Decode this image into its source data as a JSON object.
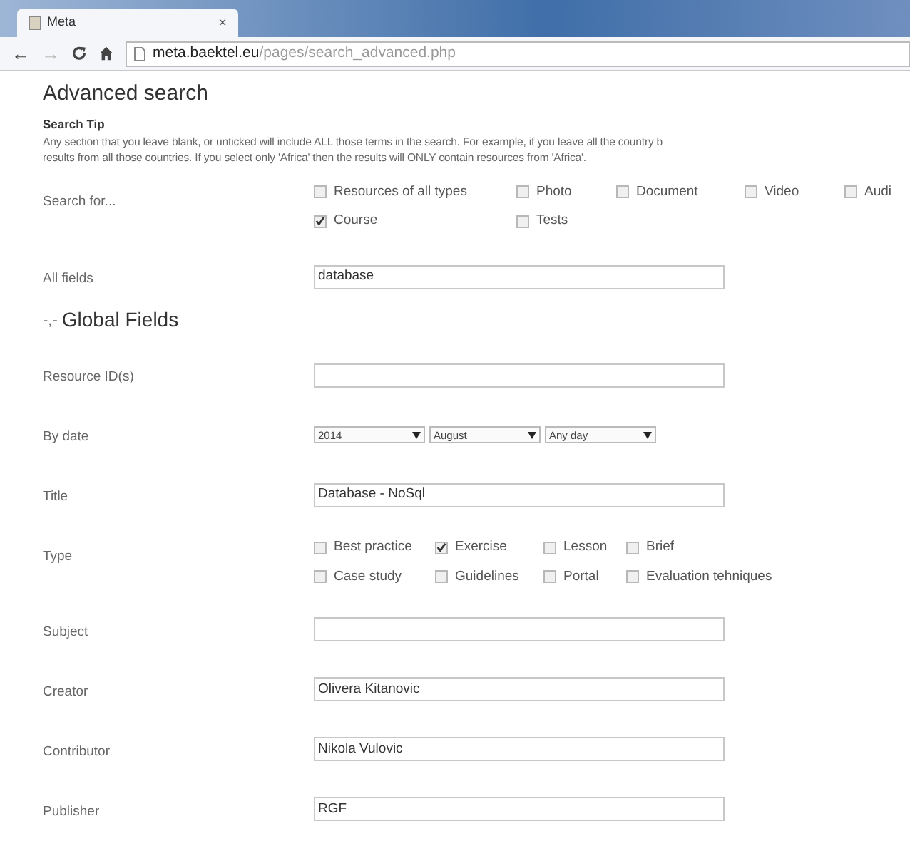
{
  "browser": {
    "tabs": [
      {
        "title": "Meta",
        "close": "×",
        "selected": true
      }
    ],
    "nav": {
      "back": "←",
      "forward": "→"
    },
    "address": {
      "host": "meta.baektel.eu",
      "path": "/pages/search_advanced.php"
    }
  },
  "page": {
    "title": "Advanced search",
    "tip": {
      "heading": "Search Tip",
      "lines": [
        "Any section that you leave blank, or unticked will include ALL those terms in the search. For example, if you leave all the country b",
        "results from all those countries. If you select only 'Africa' then the results will ONLY contain resources from 'Africa'."
      ]
    },
    "search_for": {
      "label": "Search for...",
      "rows": [
        [
          {
            "label": "Resources of all types",
            "checked": false
          },
          {
            "label": "Photo",
            "checked": false
          },
          {
            "label": "Document",
            "checked": false
          },
          {
            "label": "Video",
            "checked": false
          },
          {
            "label": "Audi",
            "checked": false
          }
        ],
        [
          {
            "label": "Course",
            "checked": true
          },
          {
            "label": "Tests",
            "checked": false
          }
        ]
      ]
    },
    "all_fields": {
      "label": "All fields",
      "value": "database"
    },
    "section": {
      "marker": "-,-",
      "title": "Global Fields"
    },
    "fields": [
      {
        "kind": "text",
        "label": "Resource ID(s)"
      },
      {
        "kind": "date",
        "label": "By date",
        "selects": [
          "2014",
          "August",
          "Any day"
        ]
      },
      {
        "kind": "text",
        "label": "Title",
        "value": "Database - NoSql"
      },
      {
        "kind": "checks",
        "label": "Type",
        "rows": [
          [
            {
              "label": "Best practice",
              "checked": false
            },
            {
              "label": "Exercise",
              "checked": true
            },
            {
              "label": "Lesson",
              "checked": false
            },
            {
              "label": "Brief",
              "checked": false
            }
          ],
          [
            {
              "label": "Case study",
              "checked": false
            },
            {
              "label": "Guidelines",
              "checked": false
            },
            {
              "label": "Portal",
              "checked": false
            },
            {
              "label": "Evaluation tehniques",
              "checked": false
            }
          ]
        ]
      },
      {
        "kind": "text",
        "label": "Subject"
      },
      {
        "kind": "text",
        "label": "Creator",
        "value": "Olivera Kitanovic"
      },
      {
        "kind": "text",
        "label": "Contributor",
        "value": "Nikola Vulovic"
      },
      {
        "kind": "text",
        "label": "Publisher",
        "value": "RGF"
      }
    ]
  }
}
